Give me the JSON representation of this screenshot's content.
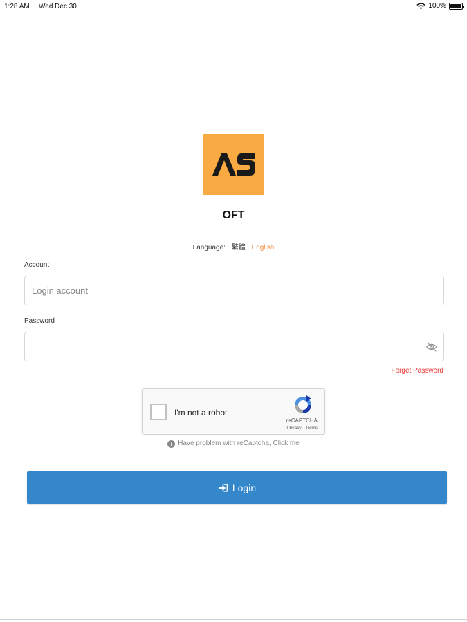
{
  "status_bar": {
    "time": "1:28 AM",
    "date": "Wed Dec 30",
    "battery_percent": "100%",
    "icons": [
      "wifi-icon",
      "battery-icon"
    ]
  },
  "logo": {
    "text": "AS",
    "background_color": "#f9aa43"
  },
  "app": {
    "name": "OFT"
  },
  "language": {
    "label": "Language:",
    "options": [
      "繁體",
      "English"
    ],
    "selected": "English",
    "selected_color": "#f58a3a"
  },
  "form": {
    "account_label": "Account",
    "account_placeholder": "Login account",
    "account_value": "",
    "password_label": "Password",
    "password_placeholder": "",
    "password_value": "",
    "password_toggle_icon": "eye-slash-icon",
    "forget_password": "Forget Password",
    "forget_password_color": "#ee3333"
  },
  "recaptcha": {
    "label": "I'm not a robot",
    "brand": "reCAPTCHA",
    "terms": "Privacy - Terms",
    "checked": false
  },
  "captcha_help": {
    "text": "Have problem with reCaptcha, Click me",
    "icon": "info-icon"
  },
  "login_button": {
    "label": "Login",
    "icon": "sign-in-icon",
    "color": "#3587cc"
  }
}
